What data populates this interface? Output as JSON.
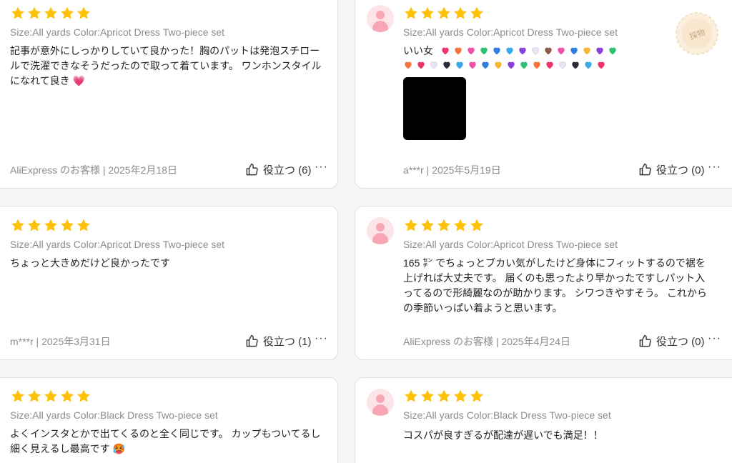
{
  "reviews": [
    {
      "rating": 5,
      "meta": "Size:All yards Color:Apricot Dress Two-piece set",
      "text": "記事が意外にしっかりしていて良かった！胸のパットは発泡スチロールで洗濯できなそうだったので取って着ています。 ワンホンスタイルになれて良き 💗",
      "author_date": "AliExpress のお客様 | 2025年2月18日",
      "helpful_label": "役立つ (6)",
      "more": "···"
    },
    {
      "rating": 5,
      "meta": "Size:All yards Color:Apricot Dress Two-piece set",
      "text": "いい女",
      "author_date": "a***r | 2025年5月19日",
      "helpful_label": "役立つ (0)",
      "more": "···",
      "badge_text": "採物"
    },
    {
      "rating": 5,
      "meta": "Size:All yards Color:Apricot Dress Two-piece set",
      "text": "ちょっと大きめだけど良かったです",
      "author_date": "m***r | 2025年3月31日",
      "helpful_label": "役立つ (1)",
      "more": "···"
    },
    {
      "rating": 5,
      "meta": "Size:All yards Color:Apricot Dress Two-piece set",
      "text": "165 ㌢ でちょっとブカい気がしたけど身体にフィットするので裾を上げれば大丈夫です。 届くのも思ったより早かったですしパット入ってるので形綺麗なのが助かります。 シワつきやすそう。 これからの季節いっぱい着ようと思います。",
      "author_date": "AliExpress のお客様 | 2025年4月24日",
      "helpful_label": "役立つ (0)",
      "more": "···"
    },
    {
      "rating": 5,
      "meta": "Size:All yards Color:Black Dress Two-piece set",
      "text": "よくインスタとかで出てくるのと全く同じです。 カップもついてるし細く見えるし最高です 🥵",
      "author_date": "",
      "helpful_label": "",
      "more": ""
    },
    {
      "rating": 5,
      "meta": "Size:All yards Color:Black Dress Two-piece set",
      "text": "コスパが良すぎるが配達が遅いでも満足！！",
      "author_date": "",
      "helpful_label": "",
      "more": ""
    }
  ],
  "heart_colors_row1": [
    "#f0336b",
    "#f5743a",
    "#f04fa8",
    "#2fbf71",
    "#2f7de1",
    "#39a9e8",
    "#8b3fd9",
    "#e8e4f2",
    "#8a5a44",
    "#f04fa8",
    "#2f7de1",
    "#f5b731",
    "#8b3fd9",
    "#2fbf71"
  ],
  "heart_colors_row2": [
    "#f5743a",
    "#f0336b",
    "#e8e4f2",
    "#2b2b3a",
    "#39a9e8",
    "#f04fa8",
    "#2f7de1",
    "#f5b731",
    "#8b3fd9",
    "#2fbf71",
    "#f5743a",
    "#f0336b",
    "#e8e4f2",
    "#2b2b3a",
    "#39a9e8",
    "#f0336b"
  ],
  "colors": {
    "star": "#ffc107",
    "avatar_bg": "#fde4e8",
    "avatar_fg": "#f7a7b4",
    "meta_text": "#8c8c8c"
  },
  "icons": {
    "star": "star-icon",
    "thumbs_up": "thumbs-up-icon",
    "avatar": "user-avatar-icon",
    "more": "more-options-icon"
  }
}
